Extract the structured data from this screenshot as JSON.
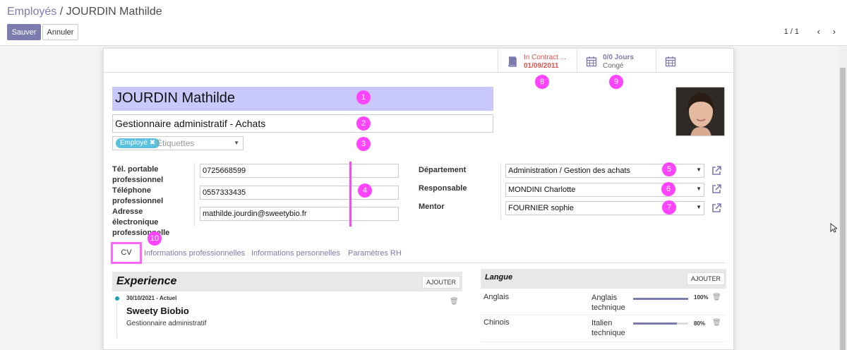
{
  "breadcrumb": {
    "parent": "Employés",
    "separator": " / ",
    "current": "JOURDIN Mathilde"
  },
  "buttons": {
    "save": "Sauver",
    "cancel": "Annuler"
  },
  "pager": {
    "value": "1 / 1",
    "prev": "‹",
    "next": "›"
  },
  "stat_buttons": [
    {
      "line1": "In Contract ...",
      "line2": "01/09/2011",
      "color": "#d9534f",
      "icon": "book-icon"
    },
    {
      "line1": "0/0 Jours",
      "line2": "Congé",
      "color": "#7c7bad",
      "icon": "calendar-icon"
    },
    {
      "line1": "",
      "line2": "",
      "color": "#7c7bad",
      "icon": "calendar-icon"
    }
  ],
  "employee": {
    "name": "JOURDIN Mathilde",
    "job_title": "Gestionnaire administratif - Achats",
    "tag": "Employé",
    "tag_remove": "✖",
    "tags_placeholder": "Étiquettes"
  },
  "contact": {
    "mobile_label": "Tél. portable professionnel",
    "mobile": "0725668599",
    "phone_label": "Téléphone professionnel",
    "phone": "0557333435",
    "email_label": "Adresse électronique professionnelle",
    "email": "mathilde.jourdin@sweetybio.fr"
  },
  "org": {
    "department_label": "Département",
    "department": "Administration / Gestion des achats",
    "manager_label": "Responsable",
    "manager": "MONDINI Charlotte",
    "coach_label": "Mentor",
    "coach": "FOURNIER sophie"
  },
  "annotations": [
    "1",
    "2",
    "3",
    "4",
    "5",
    "6",
    "7",
    "8",
    "9",
    "10"
  ],
  "tabs": [
    "CV",
    "Informations professionnelles",
    "Informations personnelles",
    "Paramètres RH"
  ],
  "resume": {
    "title": "Experience",
    "add_label": "AJOUTER",
    "entry": {
      "date": "30/10/2021 - Actuel",
      "name": "Sweety Biobio",
      "desc": "Gestionnaire administratif"
    }
  },
  "skills": {
    "title": "Langue",
    "add_label": "AJOUTER",
    "rows": [
      {
        "skill": "Anglais",
        "level": "Anglais technique",
        "level_line1": "Anglais",
        "level_line2": "technique",
        "progress": 100,
        "progress_label": "100%"
      },
      {
        "skill": "Chinois",
        "level": "Italien technique",
        "level_line1": "Italien",
        "level_line2": "technique",
        "progress": 80,
        "progress_label": "80%"
      }
    ]
  },
  "colors": {
    "primary": "#7c7bad",
    "annotation": "#ff44ff",
    "name_highlight": "#c8c8fa",
    "tag": "#5bc0de",
    "danger": "#d9534f"
  }
}
